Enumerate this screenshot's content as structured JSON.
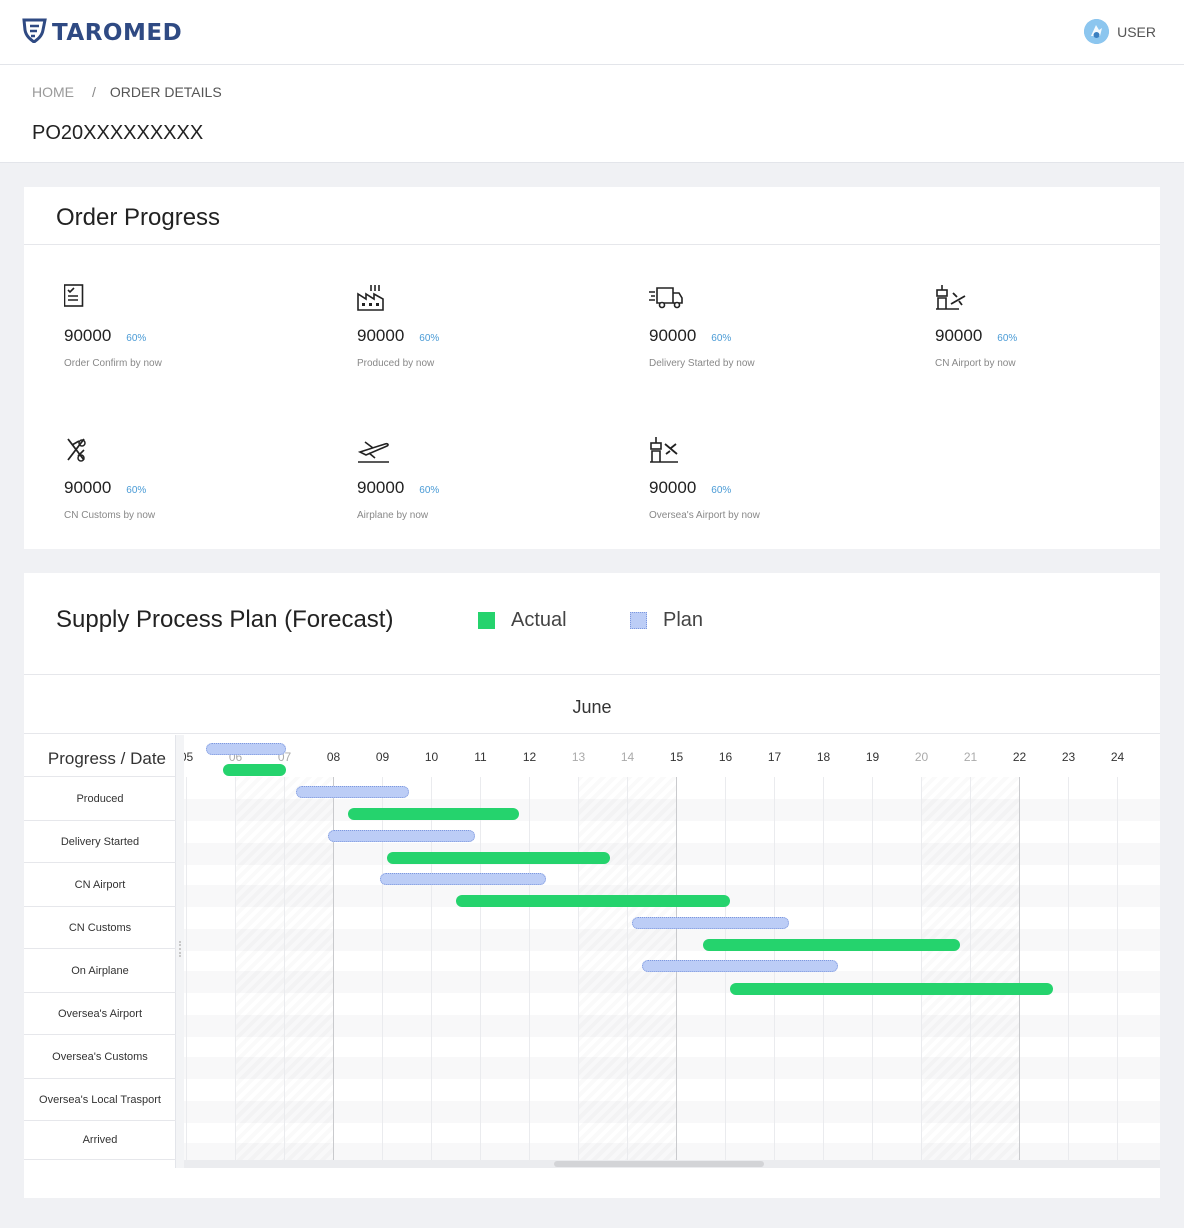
{
  "header": {
    "brand": "TAROMED",
    "user_label": "USER",
    "icons": {
      "logo": "shield-logo-icon",
      "avatar": "user-avatar-icon"
    }
  },
  "breadcrumb": {
    "home": "HOME",
    "separator": "/",
    "current": "ORDER DETAILS"
  },
  "order_id": "PO20XXXXXXXXX",
  "order_progress": {
    "title": "Order Progress",
    "stats": [
      {
        "icon": "clipboard-check-icon",
        "value": "90000",
        "percent": "60%",
        "label": "Order Confirm by now"
      },
      {
        "icon": "factory-icon",
        "value": "90000",
        "percent": "60%",
        "label": "Produced by now"
      },
      {
        "icon": "delivery-truck-icon",
        "value": "90000",
        "percent": "60%",
        "label": "Delivery Started by now"
      },
      {
        "icon": "airport-tower-icon",
        "value": "90000",
        "percent": "60%",
        "label": "CN Airport by now"
      },
      {
        "icon": "customs-icon",
        "value": "90000",
        "percent": "60%",
        "label": "CN Customs by now"
      },
      {
        "icon": "airplane-takeoff-icon",
        "value": "90000",
        "percent": "60%",
        "label": "Airplane by now"
      },
      {
        "icon": "airport-landing-icon",
        "value": "90000",
        "percent": "60%",
        "label": "Oversea's Airport by now"
      }
    ]
  },
  "supply_plan": {
    "title": "Supply Process Plan (Forecast)",
    "legend": [
      {
        "label": "Actual",
        "color": "#25d36d",
        "style": "solid"
      },
      {
        "label": "Plan",
        "color": "#bccdf6",
        "style": "dotted"
      }
    ],
    "month": "June",
    "column_header": "Progress / Date",
    "days": [
      "05",
      "06",
      "07",
      "08",
      "09",
      "10",
      "11",
      "12",
      "13",
      "14",
      "15",
      "16",
      "17",
      "18",
      "19",
      "20",
      "21",
      "22",
      "23",
      "24"
    ],
    "weekend_days": [
      "06",
      "07",
      "13",
      "14",
      "20",
      "21"
    ],
    "stages": [
      "Produced",
      "Delivery Started",
      "CN Airport",
      "CN Customs",
      "On Airplane",
      "Oversea's Airport",
      "Oversea's Customs",
      "Oversea's Local Trasport",
      "Arrived"
    ],
    "bars": [
      {
        "stage": "Produced",
        "type": "plan",
        "start": 5.4,
        "end": 7.05
      },
      {
        "stage": "Produced",
        "type": "actual",
        "start": 5.75,
        "end": 7.05
      },
      {
        "stage": "Delivery Started",
        "type": "plan",
        "start": 7.25,
        "end": 9.55
      },
      {
        "stage": "Delivery Started",
        "type": "actual",
        "start": 8.3,
        "end": 11.8
      },
      {
        "stage": "CN Airport",
        "type": "plan",
        "start": 7.9,
        "end": 10.9
      },
      {
        "stage": "CN Airport",
        "type": "actual",
        "start": 9.1,
        "end": 13.65
      },
      {
        "stage": "CN Customs",
        "type": "plan",
        "start": 8.95,
        "end": 12.35
      },
      {
        "stage": "CN Customs",
        "type": "actual",
        "start": 10.5,
        "end": 16.1
      },
      {
        "stage": "On Airplane",
        "type": "plan",
        "start": 14.1,
        "end": 17.3
      },
      {
        "stage": "On Airplane",
        "type": "actual",
        "start": 15.55,
        "end": 20.8
      },
      {
        "stage": "Oversea's Airport",
        "type": "plan",
        "start": 14.3,
        "end": 18.3
      },
      {
        "stage": "Oversea's Airport",
        "type": "actual",
        "start": 16.1,
        "end": 22.7
      }
    ]
  }
}
